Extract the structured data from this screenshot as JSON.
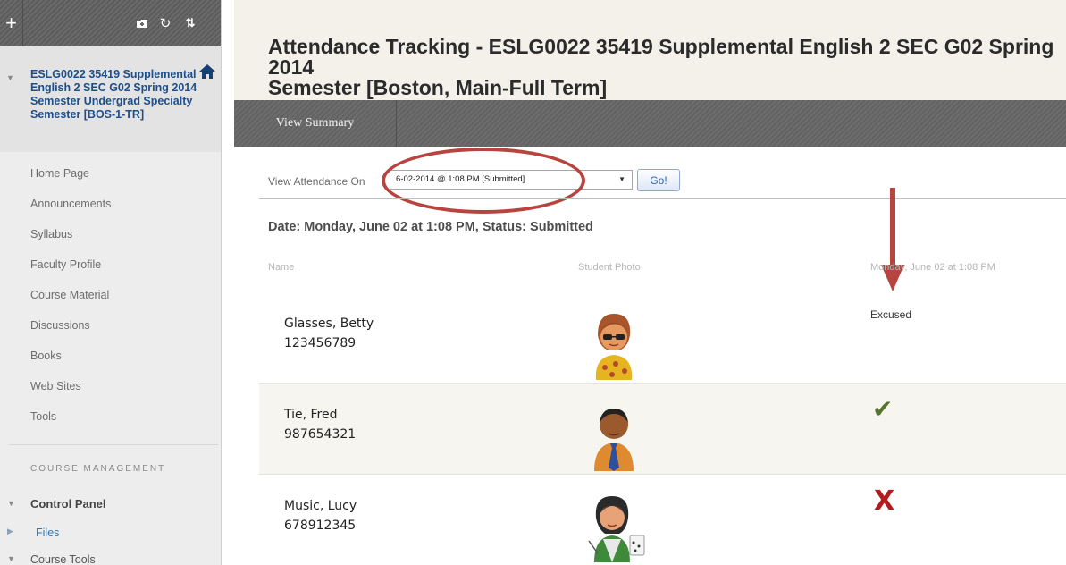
{
  "sidebar": {
    "toolbar": {
      "add_icon": "plus-icon",
      "folder_icon": "folder-icon",
      "refresh_icon": "refresh-icon",
      "sort_icon": "sort-icon"
    },
    "course_title": "ESLG0022 35419 Supplemental English 2 SEC G02 Spring 2014 Semester Undergrad Specialty Semester [BOS-1-TR]",
    "home_icon": "home-icon",
    "nav_items": [
      {
        "label": "Home Page"
      },
      {
        "label": "Announcements"
      },
      {
        "label": "Syllabus"
      },
      {
        "label": "Faculty Profile"
      },
      {
        "label": "Course Material"
      },
      {
        "label": "Discussions"
      },
      {
        "label": "Books"
      },
      {
        "label": "Web Sites"
      },
      {
        "label": "Tools"
      }
    ],
    "course_management": {
      "heading": "COURSE MANAGEMENT",
      "control_panel": "Control Panel",
      "files": "Files",
      "course_tools": "Course Tools"
    }
  },
  "main": {
    "title": "Attendance Tracking - ESLG0022 35419 Supplemental English 2 SEC G02 Spring 2014\nSemester [Boston, Main-Full Term]",
    "view_summary_label": "View Summary",
    "view_attendance_label": "View Attendance On",
    "date_select_value": "6-02-2014 @ 1:08 PM [Submitted]",
    "go_label": "Go!",
    "status_line": "Date: Monday, June 02 at 1:08 PM, Status: Submitted",
    "columns": {
      "name": "Name",
      "photo": "Student Photo",
      "date": "Monday, June 02 at 1:08 PM"
    },
    "rows": [
      {
        "name": "Glasses, Betty",
        "id": "123456789",
        "status": "Excused",
        "status_kind": "text",
        "photo_icon": "student-female-sunglasses-icon"
      },
      {
        "name": "Tie, Fred",
        "id": "987654321",
        "status": "✔",
        "status_kind": "check",
        "photo_icon": "student-male-tie-icon"
      },
      {
        "name": "Music, Lucy",
        "id": "678912345",
        "status": "X",
        "status_kind": "x",
        "photo_icon": "student-female-music-icon"
      }
    ],
    "colors": {
      "highlight": "#b8443f",
      "check": "#56742e",
      "x_mark": "#b11d1d",
      "link": "#1d4f8c"
    }
  }
}
